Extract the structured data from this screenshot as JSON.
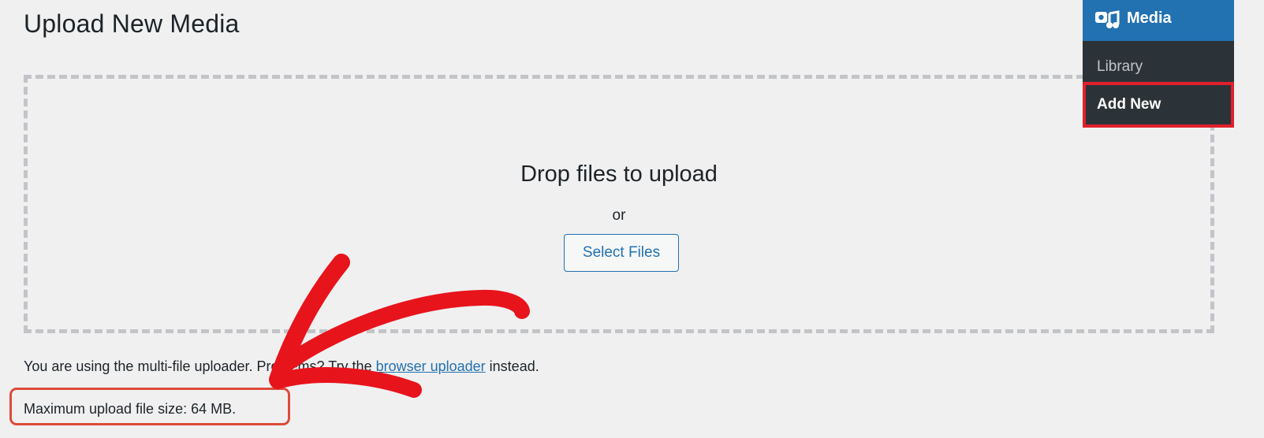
{
  "page": {
    "title": "Upload New Media"
  },
  "uploader": {
    "drop_title": "Drop files to upload",
    "or_label": "or",
    "select_files_label": "Select Files"
  },
  "note": {
    "prefix": "You are using the multi-file uploa",
    "link_text": "browser uploader",
    "suffix": " instead.",
    "hidden_text": "der. Problems? Try the "
  },
  "max_size": {
    "text": "Maximum upload file size: 64 MB."
  },
  "admin_menu": {
    "header_label": "Media",
    "header_icon": "media-icon",
    "items": [
      {
        "label": "Library"
      },
      {
        "label": "Add New"
      }
    ]
  },
  "colors": {
    "accent": "#2271b1",
    "menu_bg": "#2c3338",
    "highlight_box": "#dd4b39",
    "arrow": "#e8141c"
  }
}
